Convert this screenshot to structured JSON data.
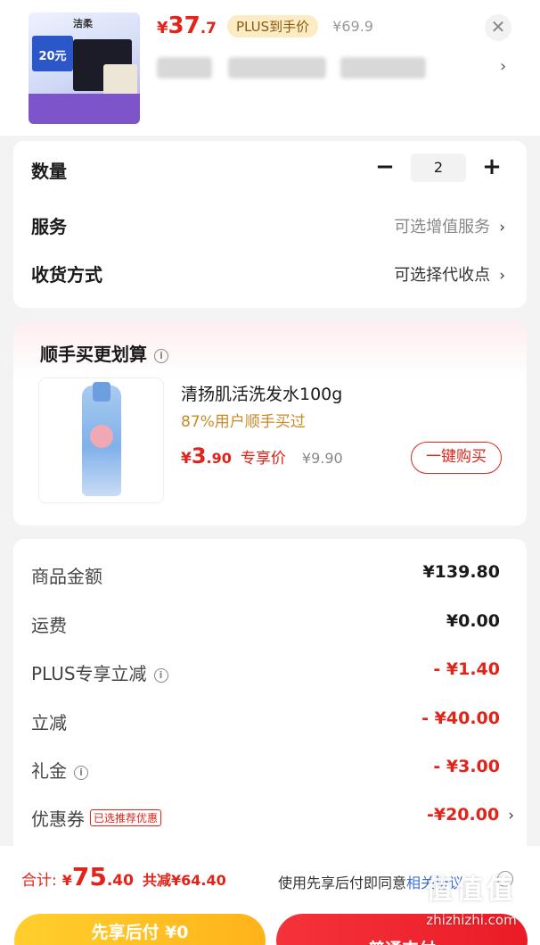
{
  "product": {
    "brand_text": "洁柔",
    "coupon_text": "20元",
    "price_yen": "¥",
    "price_int": "37",
    "price_dec": ".7",
    "plus_tag": "PLUS到手价",
    "original_price": "¥69.9",
    "close_icon": "close-icon",
    "spec_chevron": "›"
  },
  "options": {
    "quantity_label": "数量",
    "quantity_value": "2",
    "minus": "−",
    "plus": "+",
    "service_label": "服务",
    "service_hint": "可选增值服务",
    "delivery_label": "收货方式",
    "delivery_hint": "可选择代收点",
    "chevron": "›"
  },
  "recommend": {
    "title": "顺手买更划算",
    "info_icon": "i",
    "name": "清扬肌活洗发水100g",
    "note": "87%用户顺手买过",
    "price_yen": "¥",
    "price_int": "3",
    "price_dec": ".90",
    "price_tag": "专享价",
    "original_price": "¥9.90",
    "buy_button": "一键购买"
  },
  "fees": {
    "items": [
      {
        "label": "商品金额",
        "value": "¥139.80"
      },
      {
        "label": "运费",
        "value": "¥0.00"
      },
      {
        "label": "PLUS专享立减",
        "value": "- ¥1.40"
      },
      {
        "label": "立减",
        "value": "- ¥40.00"
      },
      {
        "label": "礼金",
        "value": "- ¥3.00"
      },
      {
        "label": "优惠券",
        "value": "-¥20.00",
        "tag": "已选推荐优惠"
      }
    ],
    "info_icon": "i",
    "chevron": "›"
  },
  "bottom": {
    "total_label": "合计:",
    "total_yen": "¥",
    "total_int": "75",
    "total_dec": ".40",
    "saving": "共减¥64.40",
    "agree_text": "使用先享后付即同意",
    "agree_link": "相关协议",
    "btn_later": "先享后付 ¥0",
    "btn_pay": "普通支付"
  },
  "watermark": {
    "line1": "值值值",
    "line2": "zhizhizhi.com"
  },
  "colors": {
    "accent_red": "#e2231a",
    "plus_gold": "#8a5a12",
    "note_orange": "#c98a28",
    "link_blue": "#3f6fd8"
  }
}
